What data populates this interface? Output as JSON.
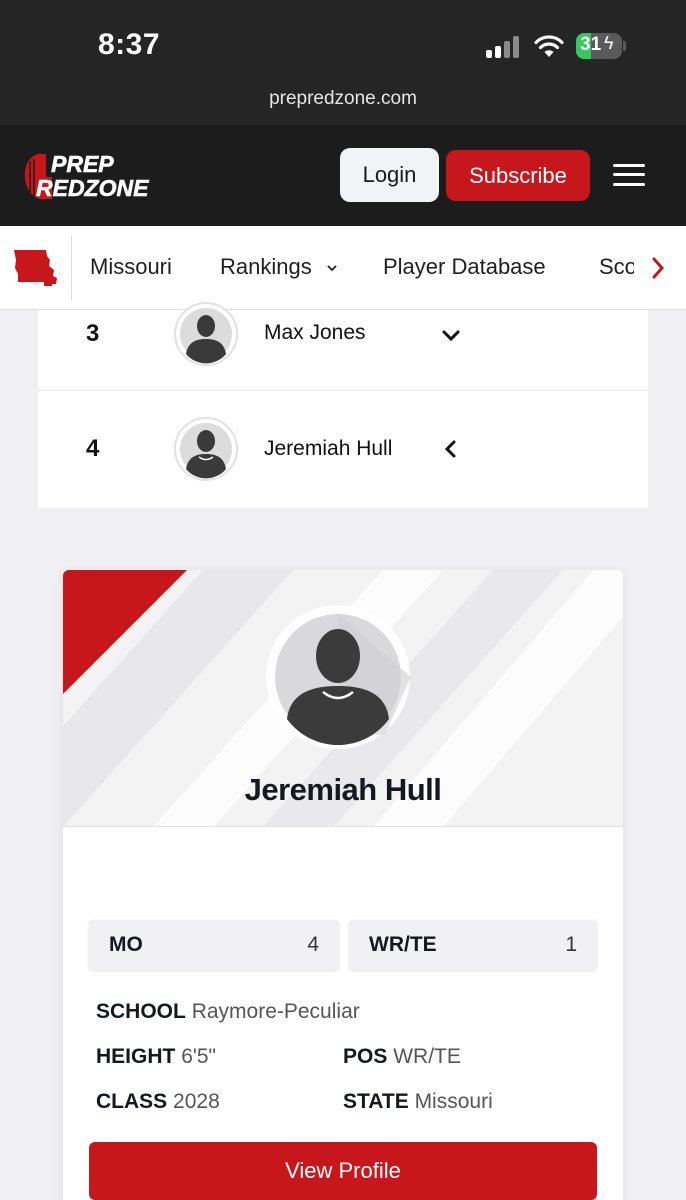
{
  "status_bar": {
    "time": "8:37",
    "battery": "31"
  },
  "browser": {
    "url": "prepredzone.com"
  },
  "header": {
    "logo_line1": "PREP",
    "logo_line2": "REDZONE",
    "login_label": "Login",
    "subscribe_label": "Subscribe"
  },
  "nav": {
    "items": [
      "Missouri",
      "Rankings",
      "Player Database",
      "Sco"
    ]
  },
  "rankings": [
    {
      "rank": "3",
      "name": "Max Jones",
      "expanded": false
    },
    {
      "rank": "4",
      "name": "Jeremiah Hull",
      "expanded": true
    }
  ],
  "profile": {
    "name": "Jeremiah Hull",
    "stats": [
      {
        "label": "MO",
        "value": "4"
      },
      {
        "label": "WR/TE",
        "value": "1"
      }
    ],
    "details": {
      "school_label": "SCHOOL",
      "school": "Raymore-Peculiar",
      "height_label": "HEIGHT",
      "height": "6'5\"",
      "pos_label": "POS",
      "pos": "WR/TE",
      "class_label": "CLASS",
      "class": "2028",
      "state_label": "STATE",
      "state": "Missouri"
    },
    "view_profile_label": "View Profile"
  },
  "colors": {
    "brand_red": "#c8161d",
    "header_bg": "#1c1c1c"
  }
}
